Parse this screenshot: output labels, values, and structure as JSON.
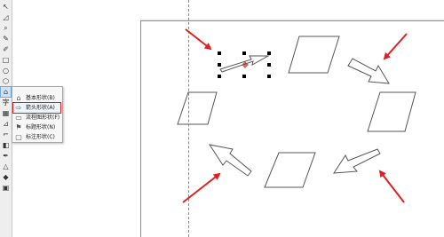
{
  "toolbar": {
    "tools": [
      {
        "name": "pick-tool-icon",
        "glyph": "↖"
      },
      {
        "name": "shape-tool-icon",
        "glyph": "◿"
      },
      {
        "name": "zoom-tool-icon",
        "glyph": "⌕"
      },
      {
        "name": "freehand-tool-icon",
        "glyph": "✎"
      },
      {
        "name": "smart-draw-tool-icon",
        "glyph": "✐"
      },
      {
        "name": "rectangle-tool-icon",
        "glyph": "□"
      },
      {
        "name": "ellipse-tool-icon",
        "glyph": "○"
      },
      {
        "name": "polygon-tool-icon",
        "glyph": "⬡"
      },
      {
        "name": "basic-shapes-tool-icon",
        "glyph": "⌂"
      },
      {
        "name": "text-tool-icon",
        "glyph": "字"
      },
      {
        "name": "table-tool-icon",
        "glyph": "▦"
      },
      {
        "name": "dimension-tool-icon",
        "glyph": "⊿"
      },
      {
        "name": "connector-tool-icon",
        "glyph": "⌐"
      },
      {
        "name": "interactive-fill-tool-icon",
        "glyph": "◧"
      },
      {
        "name": "eyedropper-tool-icon",
        "glyph": "✒"
      },
      {
        "name": "outline-tool-icon",
        "glyph": "△"
      },
      {
        "name": "fill-tool-icon",
        "glyph": "◆"
      },
      {
        "name": "smart-fill-tool-icon",
        "glyph": "▣"
      }
    ],
    "active_index": 8
  },
  "flyout": {
    "items": [
      {
        "label": "基本形状(B)",
        "icon": "basic-shape-icon",
        "glyph": "⌂",
        "highlighted": false
      },
      {
        "label": "箭头形状(A)",
        "icon": "arrow-shape-icon",
        "glyph": "⇨",
        "highlighted": true
      },
      {
        "label": "流程图形状(F)",
        "icon": "flowchart-shape-icon",
        "glyph": "▭",
        "highlighted": false
      },
      {
        "label": "标题形状(N)",
        "icon": "banner-shape-icon",
        "glyph": "⚑",
        "highlighted": false
      },
      {
        "label": "标注形状(C)",
        "icon": "callout-shape-icon",
        "glyph": "▢",
        "highlighted": false
      }
    ]
  },
  "canvas": {
    "colors": {
      "annotation_arrow": "#e02020",
      "shape_stroke": "#555555",
      "selection_handle": "#000000"
    }
  }
}
